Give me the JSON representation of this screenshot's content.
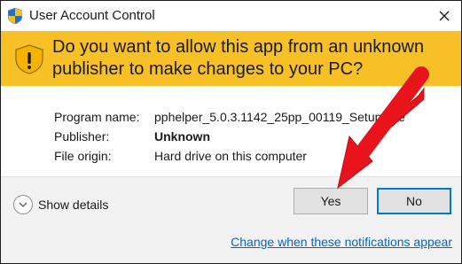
{
  "window": {
    "title": "User Account Control",
    "icons": {
      "shield": "uac-shield-icon",
      "close": "close-icon"
    }
  },
  "banner": {
    "question": "Do you want to allow this app from an unknown publisher to make changes to your PC?",
    "icon": "warning-shield-icon",
    "color": "#f6c026"
  },
  "details": {
    "program_name": {
      "label": "Program name:",
      "value": "pphelper_5.0.3.1142_25pp_00119_Setup.exe"
    },
    "publisher": {
      "label": "Publisher:",
      "value": "Unknown"
    },
    "file_origin": {
      "label": "File origin:",
      "value": "Hard drive on this computer"
    }
  },
  "footer": {
    "show_details": "Show details",
    "yes_label": "Yes",
    "no_label": "No",
    "notifications_link": "Change when these notifications appear"
  },
  "annotation": {
    "arrow_color": "#e8141c",
    "points_to": "yes-button"
  }
}
